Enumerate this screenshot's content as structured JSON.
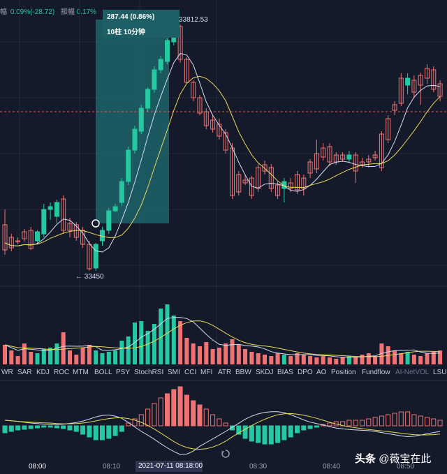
{
  "colors": {
    "bg": "#151a2a",
    "up": "#24c9a0",
    "down": "#f07373",
    "ma1": "#d6dcf0",
    "ma2": "#e8d85a",
    "highlight": "#1f6e73",
    "dashed": "#d65a5a",
    "grid": "#232a3d"
  },
  "header": {
    "partial_char": "幅",
    "change_text": "0.09%(-28.72)",
    "amplitude_label": "振幅",
    "amplitude_value": "0.17%"
  },
  "selection": {
    "change": "287.44 (0.86%)",
    "bars": "10柱 10分钟"
  },
  "price_markers": {
    "high": "33812.53",
    "low": "← 33450"
  },
  "indicators": [
    "WR",
    "SAR",
    "KDJ",
    "ROC",
    "MTM",
    "BOLL",
    "PSY",
    "StochRSI",
    "SMI",
    "CCI",
    "MFI",
    "ATR",
    "BBW",
    "SKDJ",
    "BIAS",
    "DPO",
    "AO",
    "Position",
    "Fundflow",
    "AI-NetVOL",
    "LSU"
  ],
  "time_axis": {
    "labels": [
      "08:00",
      "08:10",
      "08:30",
      "08:40",
      "08:50"
    ],
    "crosshair": "2021-07-11 08:18:00"
  },
  "watermark": {
    "brand": "头条",
    "handle": "@薇宝在此"
  },
  "icons": {
    "reset": "reset-icon"
  },
  "chart_data": {
    "type": "candlestick",
    "x_ticks": [
      "08:00",
      "08:10",
      "08:18:00",
      "08:30",
      "08:40",
      "08:50"
    ],
    "price_high": 33812.53,
    "price_low": 33450,
    "selection_change": 287.44,
    "selection_change_pct": 0.86,
    "selection_bars": 10
  }
}
